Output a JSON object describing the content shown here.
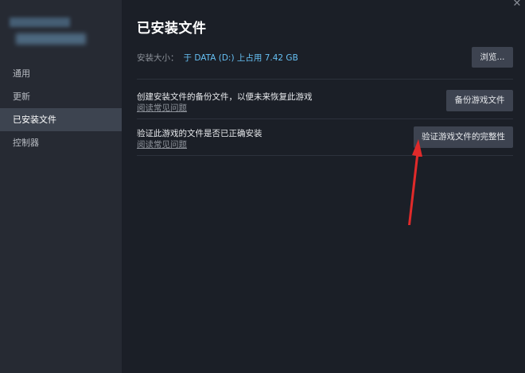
{
  "sidebar": {
    "items": [
      {
        "label": "通用"
      },
      {
        "label": "更新"
      },
      {
        "label": "已安装文件",
        "active": true
      },
      {
        "label": "控制器"
      }
    ]
  },
  "main": {
    "title": "已安装文件",
    "install_size": {
      "label": "安装大小：",
      "value": "于 DATA (D:) 上占用 7.42 GB"
    },
    "browse_button": "浏览...",
    "backup": {
      "text": "创建安装文件的备份文件，以便未来恢复此游戏",
      "link": "阅读常见问题",
      "button": "备份游戏文件"
    },
    "verify": {
      "text": "验证此游戏的文件是否已正确安装",
      "link": "阅读常见问题",
      "button": "验证游戏文件的完整性"
    }
  },
  "window": {
    "close_glyph": "✕"
  },
  "colors": {
    "sidebar_bg": "#262a33",
    "main_bg": "#1b1f27",
    "active_item_bg": "#3d4450",
    "accent_link": "#66c0f4",
    "button_bg": "#3d4350",
    "annotation_arrow": "#e02a2a"
  }
}
